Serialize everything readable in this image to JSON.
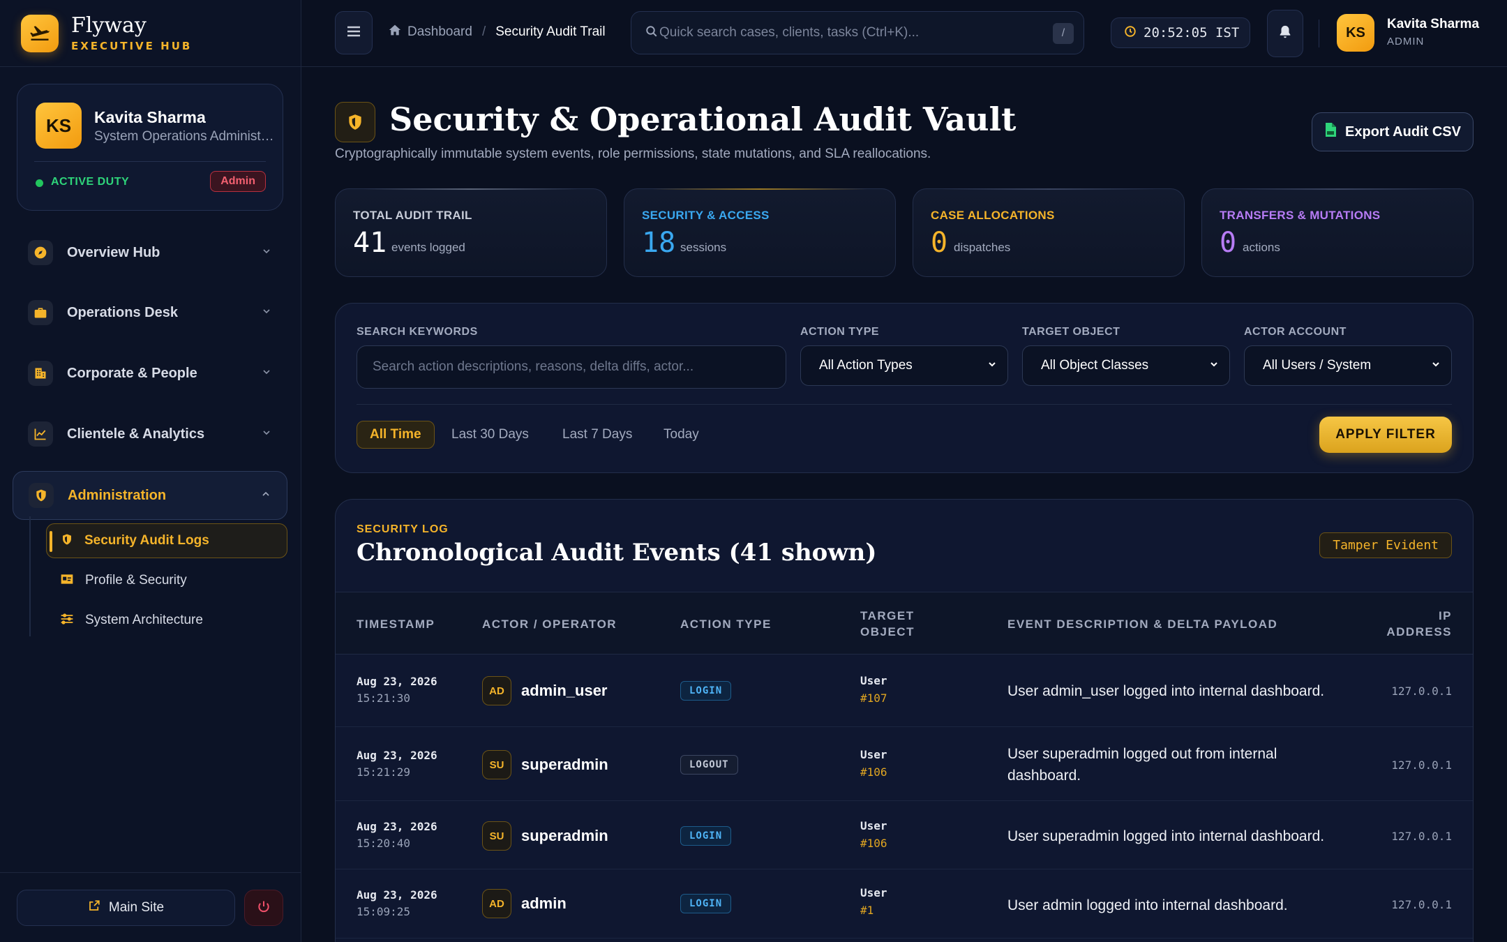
{
  "brand": {
    "name": "Flyway",
    "sub": "EXECUTIVE HUB"
  },
  "profile": {
    "initials": "KS",
    "name": "Kavita Sharma",
    "role": "System Operations Administrator",
    "status": "ACTIVE DUTY",
    "badge": "Admin"
  },
  "nav": {
    "items": [
      {
        "label": "Overview Hub",
        "icon": "compass-icon"
      },
      {
        "label": "Operations Desk",
        "icon": "briefcase-icon"
      },
      {
        "label": "Corporate & People",
        "icon": "building-icon"
      },
      {
        "label": "Clientele & Analytics",
        "icon": "chart-icon"
      },
      {
        "label": "Administration",
        "icon": "shield-icon"
      }
    ],
    "sub_items": [
      {
        "label": "Security Audit Logs",
        "icon": "shield-icon"
      },
      {
        "label": "Profile & Security",
        "icon": "id-card-icon"
      },
      {
        "label": "System Architecture",
        "icon": "sliders-icon"
      }
    ],
    "main_site": "Main Site"
  },
  "topbar": {
    "breadcrumb_home": "Dashboard",
    "breadcrumb_current": "Security Audit Trail",
    "search_placeholder": "Quick search cases, clients, tasks (Ctrl+K)...",
    "search_kbd": "/",
    "clock": "20:52:05 IST",
    "user_initials": "KS",
    "user_name": "Kavita Sharma",
    "user_role": "ADMIN"
  },
  "page": {
    "title": "Security & Operational Audit Vault",
    "subtitle": "Cryptographically immutable system events, role permissions, state mutations, and SLA reallocations.",
    "export_label": "Export Audit CSV"
  },
  "stats": [
    {
      "label": "TOTAL AUDIT TRAIL",
      "value": "41",
      "unit": "events logged",
      "color": "#c7ccd8",
      "value_color": "#ffffff",
      "accent": "#5b6478"
    },
    {
      "label": "SECURITY & ACCESS",
      "value": "18",
      "unit": "sessions",
      "color": "#3aa8f0",
      "value_color": "#3aa8f0",
      "accent": "#9c7a25"
    },
    {
      "label": "CASE ALLOCATIONS",
      "value": "0",
      "unit": "dispatches",
      "color": "#f5b42a",
      "value_color": "#f5b42a",
      "accent": "#3a4460"
    },
    {
      "label": "TRANSFERS & MUTATIONS",
      "value": "0",
      "unit": "actions",
      "color": "#b77cf5",
      "value_color": "#b77cf5",
      "accent": "#3a4460"
    }
  ],
  "filters": {
    "keywords_label": "SEARCH KEYWORDS",
    "keywords_placeholder": "Search action descriptions, reasons, delta diffs, actor...",
    "action_label": "ACTION TYPE",
    "action_value": "All Action Types",
    "object_label": "TARGET OBJECT",
    "object_value": "All Object Classes",
    "actor_label": "ACTOR ACCOUNT",
    "actor_value": "All Users / System",
    "ranges": [
      "All Time",
      "Last 30 Days",
      "Last 7 Days",
      "Today"
    ],
    "apply_label": "APPLY FILTER"
  },
  "table": {
    "eyebrow": "SECURITY LOG",
    "title": "Chronological Audit Events (41 shown)",
    "badge": "Tamper Evident",
    "headers": {
      "timestamp": "TIMESTAMP",
      "actor": "ACTOR / OPERATOR",
      "action": "ACTION TYPE",
      "target_1": "TARGET",
      "target_2": "OBJECT",
      "desc": "EVENT DESCRIPTION & DELTA PAYLOAD",
      "ip_1": "IP",
      "ip_2": "ADDRESS"
    },
    "rows": [
      {
        "date": "Aug 23, 2026",
        "time": "15:21:30",
        "initials": "AD",
        "actor": "admin_user",
        "action": "LOGIN",
        "target": "User",
        "target_id": "#107",
        "desc": "User admin_user logged into internal dashboard.",
        "ip": "127.0.0.1"
      },
      {
        "date": "Aug 23, 2026",
        "time": "15:21:29",
        "initials": "SU",
        "actor": "superadmin",
        "action": "LOGOUT",
        "target": "User",
        "target_id": "#106",
        "desc": "User superadmin logged out from internal dashboard.",
        "ip": "127.0.0.1"
      },
      {
        "date": "Aug 23, 2026",
        "time": "15:20:40",
        "initials": "SU",
        "actor": "superadmin",
        "action": "LOGIN",
        "target": "User",
        "target_id": "#106",
        "desc": "User superadmin logged into internal dashboard.",
        "ip": "127.0.0.1"
      },
      {
        "date": "Aug 23, 2026",
        "time": "15:09:25",
        "initials": "AD",
        "actor": "admin",
        "action": "LOGIN",
        "target": "User",
        "target_id": "#1",
        "desc": "User admin logged into internal dashboard.",
        "ip": "127.0.0.1"
      }
    ]
  }
}
